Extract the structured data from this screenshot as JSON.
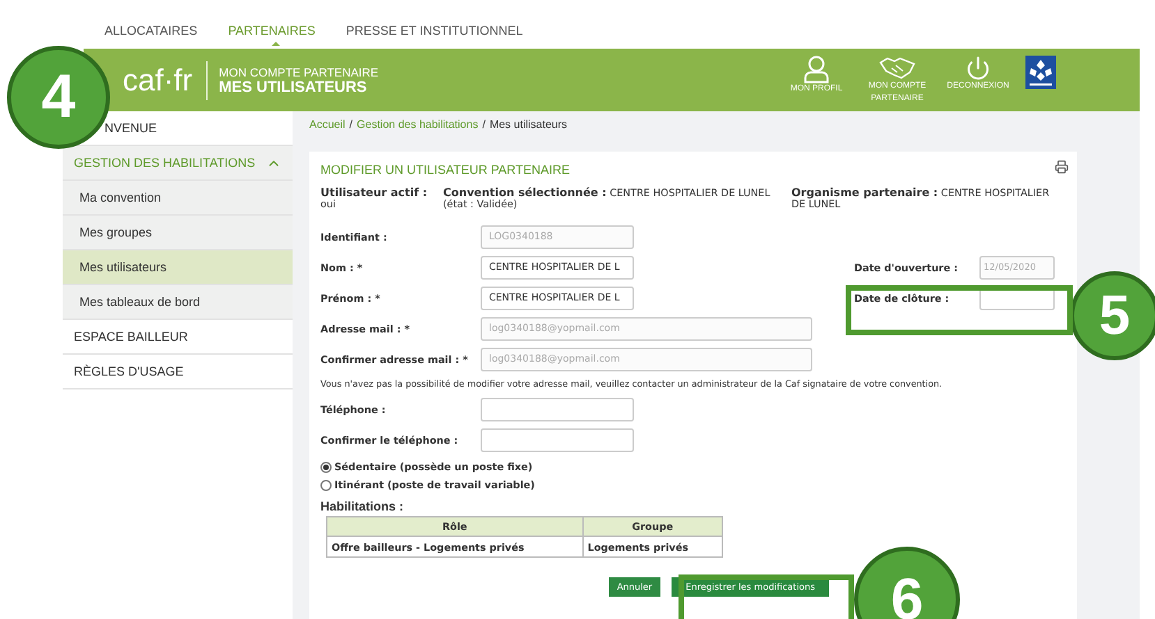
{
  "top_nav": [
    {
      "label": "ALLOCATAIRES",
      "selected": false
    },
    {
      "label": "PARTENAIRES",
      "selected": true
    },
    {
      "label": "PRESSE ET INSTITUTIONNEL",
      "selected": false
    }
  ],
  "header": {
    "logo": "caf·fr",
    "subtitle": "MON COMPTE PARTENAIRE",
    "title": "MES UTILISATEURS",
    "actions": [
      {
        "label": "MON PROFIL",
        "kind": "profile"
      },
      {
        "label": "MON COMPTE PARTENAIRE",
        "kind": "partner"
      },
      {
        "label": "DECONNEXION",
        "kind": "logout"
      }
    ]
  },
  "sidebar": [
    {
      "label": "NVENUE"
    },
    {
      "label": "GESTION DES HABILITATIONS",
      "expanded": true,
      "children": [
        {
          "label": "Ma convention",
          "selected": false
        },
        {
          "label": "Mes groupes",
          "selected": false
        },
        {
          "label": "Mes utilisateurs",
          "selected": true
        },
        {
          "label": "Mes tableaux de bord",
          "selected": false
        }
      ]
    },
    {
      "label": "ESPACE BAILLEUR"
    },
    {
      "label": "RÈGLES D'USAGE"
    }
  ],
  "breadcrumb": {
    "separator": "/",
    "items": [
      "Accueil",
      "Gestion des habilitations",
      "Mes utilisateurs"
    ]
  },
  "form": {
    "title": "MODIFIER UN UTILISATEUR PARTENAIRE",
    "summary": [
      "**Utilisateur actif :** oui",
      "**Convention sélectionnée :** CENTRE HOSPITALIER DE LUNEL (état : Validée)",
      "**Organisme partenaire :** CENTRE HOSPITALIER DE LUNEL"
    ],
    "fields": [
      {
        "label": "Identifiant :",
        "value": "LOG0340188",
        "disabled": true,
        "kind": "short"
      },
      {
        "label": "Nom : *",
        "value": "CENTRE HOSPITALIER DE L",
        "disabled": false,
        "kind": "short"
      },
      {
        "label": "Prénom : *",
        "value": "CENTRE HOSPITALIER DE L",
        "disabled": false,
        "kind": "short"
      },
      {
        "label": "Adresse mail : *",
        "value": "log0340188@yopmail.com",
        "disabled": true,
        "kind": "long"
      },
      {
        "label": "Confirmer adresse mail : *",
        "value": "log0340188@yopmail.com",
        "disabled": true,
        "kind": "long"
      }
    ],
    "date_fields": [
      {
        "label": "Date d'ouverture :",
        "value": "12/05/2020",
        "disabled": true
      },
      {
        "label": "Date de clôture :"
      }
    ],
    "notice": "Vous n'avez pas la possibilité de modifier votre adresse mail, veuillez contacter un administrateur de la Caf signataire de votre convention.",
    "phone_fields": [
      {
        "label": "Téléphone :"
      },
      {
        "label": "Confirmer le téléphone :"
      }
    ],
    "radios": [
      {
        "label": "Sédentaire (possède un poste fixe)",
        "selected": true
      },
      {
        "label": "Itinérant (poste de travail variable)",
        "selected": false
      }
    ],
    "habilitations": {
      "title": "Habilitations :",
      "columns": [
        "Rôle",
        "Groupe"
      ],
      "rows": [
        [
          "Offre bailleurs - Logements privés",
          "Logements privés"
        ]
      ]
    },
    "buttons": [
      {
        "label": "Annuler",
        "kind": "secondary"
      },
      {
        "label": "Enregistrer les modifications",
        "kind": "primary"
      }
    ]
  },
  "annotations": [
    {
      "label": "4",
      "kind": "circle"
    },
    {
      "label": "5",
      "kind": "circle"
    },
    {
      "label": "6",
      "kind": "circle"
    },
    {
      "kind": "highlight"
    },
    {
      "kind": "highlight"
    }
  ]
}
